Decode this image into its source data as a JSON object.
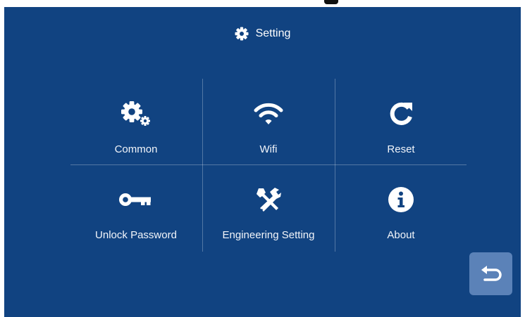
{
  "header": {
    "title": "Setting",
    "icon": "gear-icon"
  },
  "tiles": [
    {
      "label": "Common",
      "icon": "gears-icon"
    },
    {
      "label": "Wifi",
      "icon": "wifi-icon"
    },
    {
      "label": "Reset",
      "icon": "refresh-icon"
    },
    {
      "label": "Unlock Password",
      "icon": "key-icon"
    },
    {
      "label": "Engineering Setting",
      "icon": "tools-icon"
    },
    {
      "label": "About",
      "icon": "info-icon"
    }
  ],
  "back_button": {
    "icon": "back-arrow-icon"
  },
  "colors": {
    "background": "#114381",
    "text": "#ffffff",
    "back_button": "#5b82b8"
  }
}
